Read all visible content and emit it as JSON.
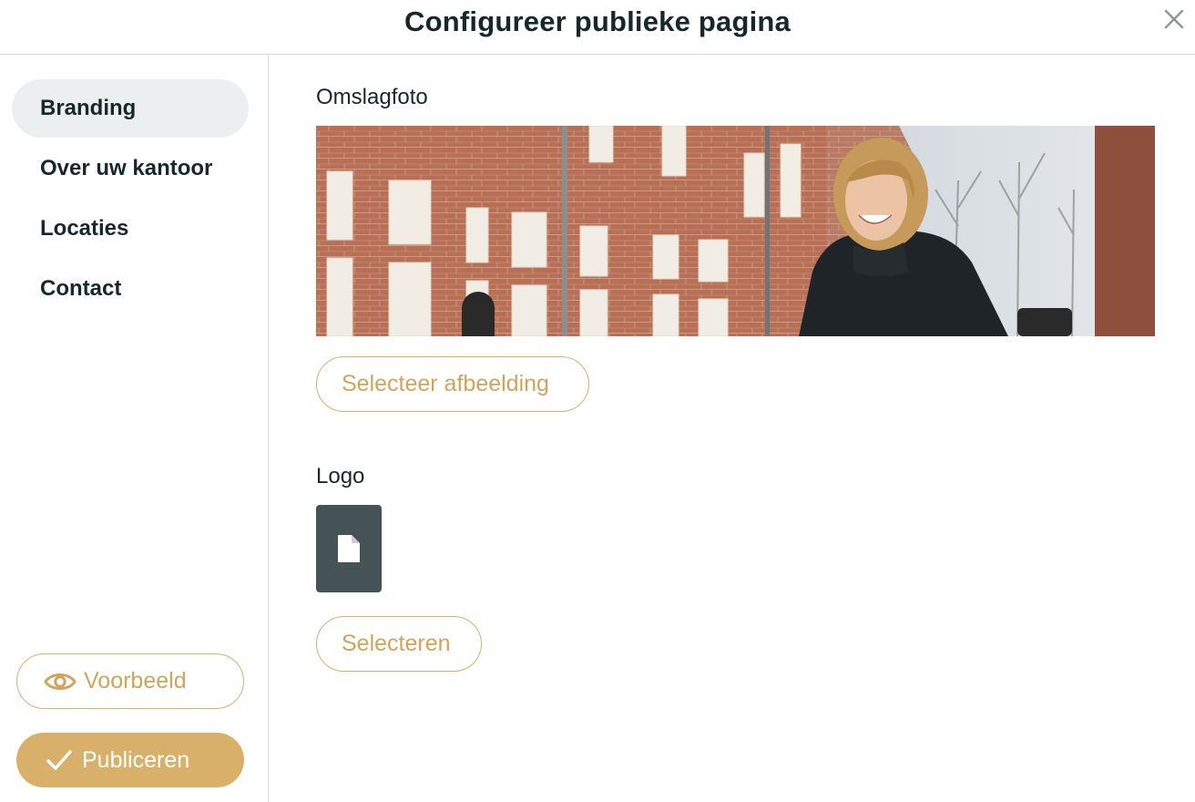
{
  "header": {
    "title": "Configureer publieke pagina",
    "close_icon": "close-icon"
  },
  "sidebar": {
    "items": [
      {
        "label": "Branding",
        "active": true
      },
      {
        "label": "Over uw kantoor",
        "active": false
      },
      {
        "label": "Locaties",
        "active": false
      },
      {
        "label": "Contact",
        "active": false
      }
    ],
    "preview_label": "Voorbeeld",
    "preview_icon": "eye-icon",
    "publish_label": "Publiceren",
    "publish_icon": "check-icon"
  },
  "main": {
    "cover": {
      "label": "Omslagfoto",
      "button_label": "Selecteer afbeelding"
    },
    "logo": {
      "label": "Logo",
      "placeholder_icon": "file-icon",
      "button_label": "Selecteren"
    }
  },
  "colors": {
    "accent": "#d8b06a",
    "text": "#17282a",
    "active_nav_bg": "#eceff0",
    "logo_tile_bg": "#465356"
  }
}
